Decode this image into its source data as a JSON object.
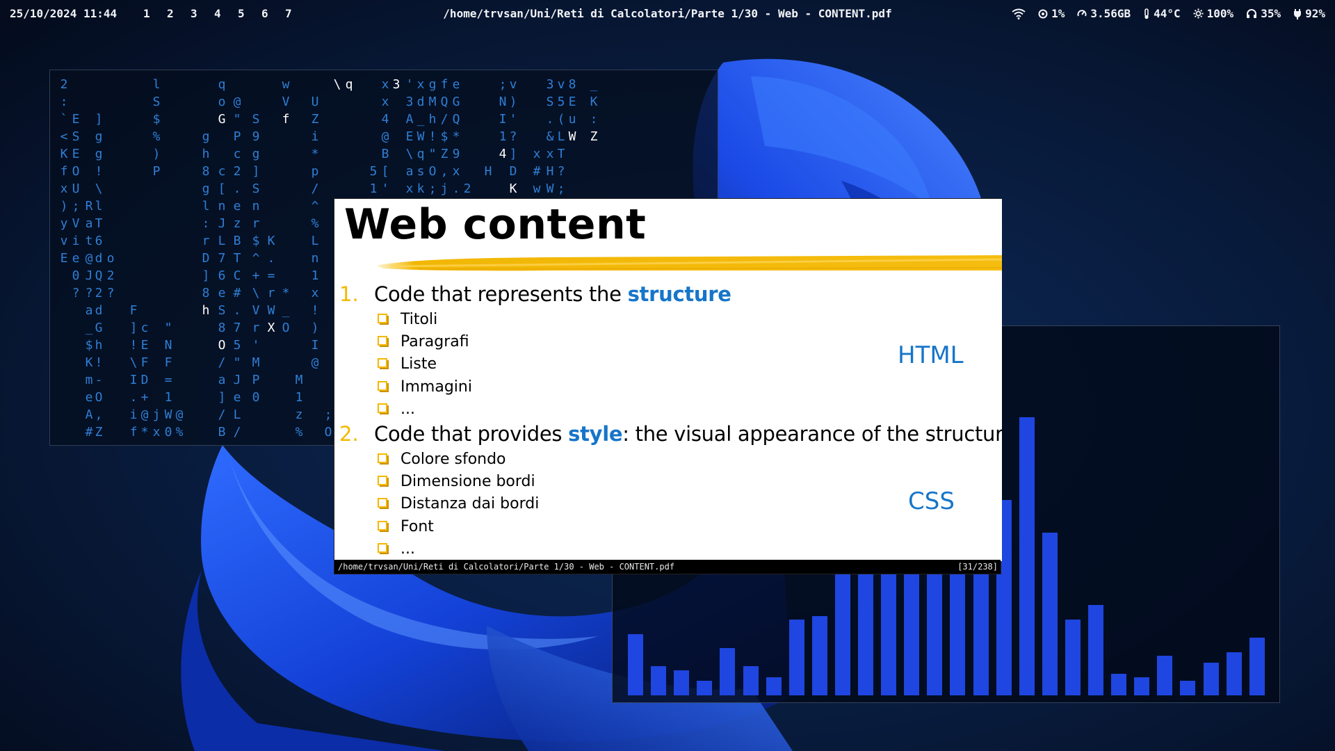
{
  "topbar": {
    "datetime": "25/10/2024 11:44",
    "workspaces": [
      "1",
      "2",
      "3",
      "4",
      "5",
      "6",
      "7"
    ],
    "window_title": "/home/trvsan/Uni/Reti di Calcolatori/Parte 1/30 - Web - CONTENT.pdf",
    "status": {
      "cpu": "1%",
      "memory": "3.56GB",
      "temperature": "44°C",
      "brightness": "100%",
      "headphones": "35%",
      "battery": "92%"
    }
  },
  "terminal": {
    "matrix_columns": [
      "2\n:\n`\n<\nK\nf\nx\n)\ny\nv\nE",
      "\n\nE\nS\nE\nO\nU\n;\nV\ni\ne\n0\n?",
      "\n\n\n\n\n\n\nR\na\nt\n@\nJ\n?\na\n_\n$\nK\nm\ne\nA\n#",
      "\n\n]\ng\ng\n!\n\\\nl\nT\n6\nd\nQ\n2\nd\nG\nh\n!\n-\nO\n,\nZ",
      "\n\n\n\n\n\n\n\n\n\no\n2\n?",
      "\n\n\n\n\n\n\n\n\n\n\n\n\nF\n]\n!\n\\\nI\n.\ni\nf",
      "\n\n\n\n\n\n\n\n\n\n\n\n\n\nc\nE\nF\nD\n+\n@\n*",
      "l\nS\n$\n%\n)\nP\n\n\n\n\n\n\n\n\n\n\n\n\n\nj\nx",
      "\n\n\n\n\n\n\n\n\n\n\n\n\n\n\"\nN\nF\n=\n1\nW\n0",
      "\n\n\n\n\n\n\n\n\n\n\n\n\n\n\n\n\n\n\n@\n%",
      "\n\n\ng\nh\n8\ng\nl\n:\nr\nD\n]\n8\nh",
      "q\no\nG\n\n\nc\n[\nn\nJ\nL\n7\n6\ne\nS\n8\nO\n/\na\n]\n/\nB",
      "\n@\n\"\nP\nc\n2\n.\ne\nz\nB\nT\nC\n#\n.\n7\n5\n\"\nJ\ne\nL\n/",
      "\n\nS\n9\ng\n]\nS\nn\nr\n$\n^\n+\n\\\nV\nr\n'\nM\nP\n0",
      "\n\n\n\n\n\n\n\n\nK\n.\n=\nr\nW\nX",
      "w\nV\nf\n\n\n\n\n\n\n\n\n\n*\n_\nO",
      "\n\n\n\n\n\n\n\n\n\n\n\n\n\n\n\n\nM\n1\nz\n%",
      "\nU\nZ\ni\n*\np\n/\n^\n%\nL\nn\n1\nx\n!\n)\nI\n@",
      "\n\n\n\n\n\n\n\n\n\n\n\n\n\n\n\n\n\n\n;\nO",
      "\\",
      "q",
      "\n\n\n\n\n5\n1",
      "x\nx\n4\n@\nB\n[\n'",
      "3",
      "'\n3\nA\nE\n\\\na\nx",
      "x\nd\n_\nW\nq\ns\nk",
      "g\nM\nh\n!\n\"\nO\n;",
      "f\nQ\n/\n$\nZ\n,\nj",
      "e\nG\nQ\n*\n9\nx\n.",
      "\n\n\n\n\n\n2",
      "\n\n\n\n\nH",
      ";\nN\nI\n1\n4",
      "v\n)\n'\n?\n]\nD\nK",
      "\n\n\n\nx\n#\nw",
      "3\nS\n.\n&\nx\nH\nW",
      "v\n5\n(\nL\nT\n?\n;",
      "8\nE\nu\nW",
      "_\nK\n:\nZ"
    ]
  },
  "visualizer": {
    "levels": [
      0.17,
      0.08,
      0.07,
      0.04,
      0.13,
      0.08,
      0.05,
      0.21,
      0.22,
      0.38,
      0.54,
      0.54,
      0.54,
      0.54,
      0.54,
      0.54,
      0.54,
      0.77,
      0.45,
      0.21,
      0.25,
      0.06,
      0.05,
      0.11,
      0.04,
      0.09,
      0.12,
      0.16
    ]
  },
  "viewer": {
    "slide": {
      "title": "Web content",
      "items": [
        {
          "num": "1.",
          "text_before": "Code that represents the ",
          "keyword": "structure",
          "text_after": "",
          "subitems": [
            "Titoli",
            "Paragrafi",
            "Liste",
            "Immagini",
            "..."
          ],
          "side_label": "HTML"
        },
        {
          "num": "2.",
          "text_before": "Code that provides ",
          "keyword": "style",
          "text_after": ": the visual appearance of the structure",
          "subitems": [
            "Colore sfondo",
            "Dimensione bordi",
            "Distanza dai bordi",
            "Font",
            "..."
          ],
          "side_label": "CSS"
        }
      ]
    },
    "status_path": "/home/trvsan/Uni/Reti di Calcolatori/Parte 1/30 - Web - CONTENT.pdf",
    "page_indicator": "[31/238]"
  },
  "colors": {
    "accent_blue": "#1675c9",
    "bullet_yellow": "#f5b800",
    "matrix_blue": "#2f7fd6",
    "visualizer_bar": "#1f46e0"
  }
}
